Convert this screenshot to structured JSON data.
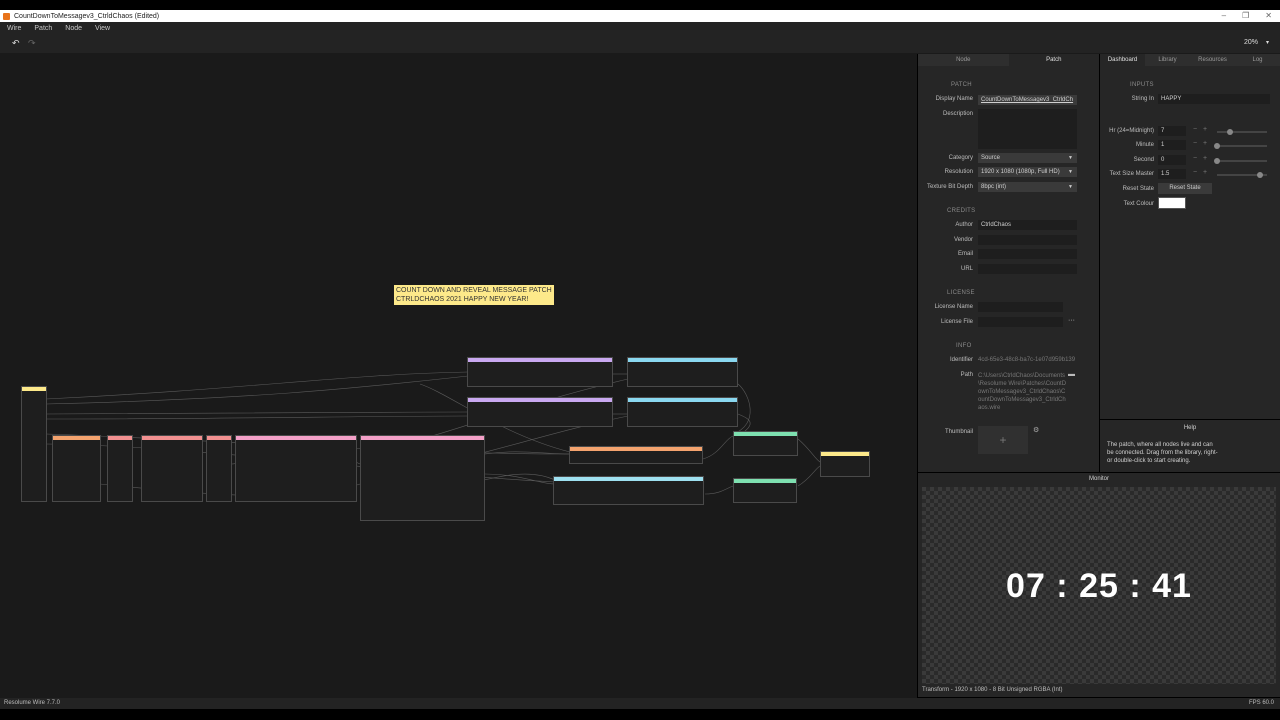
{
  "window": {
    "title": "CountDownToMessagev3_CtrldChaos (Edited)"
  },
  "menu": [
    "Wire",
    "Patch",
    "Node",
    "View"
  ],
  "toolbar": {
    "zoom": "20%"
  },
  "canvas": {
    "note_line1": "COUNT DOWN AND REVEAL MESSAGE PATCH",
    "note_line2": "CTRLDCHAOS 2021 HAPPY NEW YEAR!"
  },
  "inspector": {
    "tabs": [
      "Node",
      "Patch"
    ],
    "patch_section": "PATCH",
    "display_name_label": "Display Name",
    "display_name_value": "CountDownToMessagev3_CtrldCh",
    "description_label": "Description",
    "category_label": "Category",
    "category_value": "Source",
    "resolution_label": "Resolution",
    "resolution_value": "1920 x 1080 (1080p, Full HD)",
    "texture_label": "Texture Bit Depth",
    "texture_value": "8bpc (int)",
    "credits_section": "CREDITS",
    "author_label": "Author",
    "author_value": "CtrldChaos",
    "vendor_label": "Vendor",
    "email_label": "Email",
    "url_label": "URL",
    "license_section": "LICENSE",
    "license_name_label": "License Name",
    "license_file_label": "License File",
    "info_section": "INFO",
    "identifier_label": "Identifier",
    "identifier_value": "4cd-65e3-48c8-ba7c-1e07d959b139",
    "path_label": "Path",
    "path_value": "C:\\Users\\CtrldChaos\\Documents\\Resolume Wire\\Patches\\CountDownToMessagev3_CtrldChaos\\CountDownToMessagev3_CtrldChaos.wire",
    "thumbnail_label": "Thumbnail"
  },
  "dashboard": {
    "tabs": [
      "Dashboard",
      "Library",
      "Resources",
      "Log"
    ],
    "inputs_section": "INPUTS",
    "string_in_label": "String In",
    "string_in_value": "HAPPY",
    "hr_label": "Hr (24=Midnight)",
    "hr_value": "7",
    "hr_fraction": 0.25,
    "minute_label": "Minute",
    "minute_value": "1",
    "minute_fraction": 0.0,
    "second_label": "Second",
    "second_value": "0",
    "second_fraction": 0.0,
    "text_size_label": "Text Size Master",
    "text_size_value": "1.5",
    "text_size_fraction": 0.85,
    "reset_label": "Reset State",
    "reset_button": "Reset State",
    "text_colour_label": "Text Colour",
    "text_colour": "#ffffff"
  },
  "help": {
    "title": "Help",
    "text1": "The patch, where all nodes live and can",
    "text2": "be connected. Drag from the library, right-",
    "text3": "or double-click to start creating."
  },
  "monitor": {
    "title": "Monitor",
    "clock": "07 : 25 : 41",
    "status": "Transform - 1920 x 1080 - 8 Bit Unsigned RGBA (Int)"
  },
  "statusbar": {
    "version": "Resolume Wire 7.7.0",
    "fps": "FPS 60.0"
  }
}
